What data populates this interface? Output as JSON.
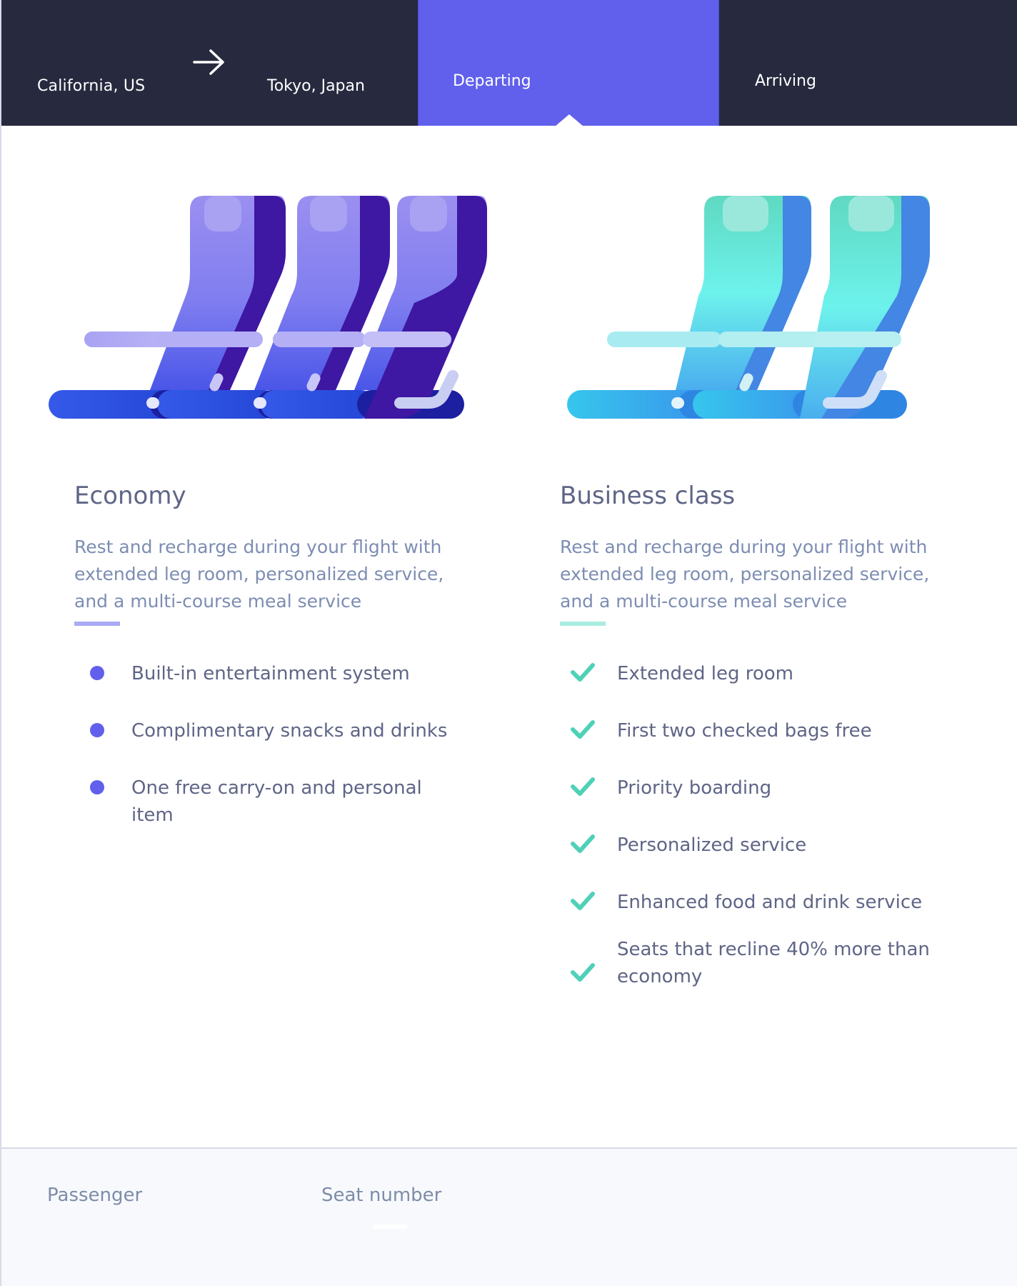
{
  "route": {
    "origin": "California, US",
    "destination": "Tokyo, Japan",
    "arrow_icon": "arrow-right-icon"
  },
  "tabs": [
    {
      "label": "Departing",
      "active": true
    },
    {
      "label": "Arriving",
      "active": false
    }
  ],
  "colors": {
    "nav_bg": "#272a3f",
    "accent_purple": "#6060ec",
    "accent_teal": "#4fd1b7",
    "text_primary": "#5f6586",
    "text_secondary": "#7d8db2"
  },
  "economy": {
    "title": "Economy",
    "description": "Rest and recharge during your flight with extended leg room, personalized service, and a multi-course meal service",
    "illustration_icon": "economy-seats-icon",
    "bullet_icon": "bullet-dot-icon",
    "features": [
      "Built-in entertainment system",
      "Complimentary snacks and drinks",
      "One free carry-on and personal item"
    ]
  },
  "business": {
    "title": "Business class",
    "description": "Rest and recharge during your flight with extended leg room, personalized service, and a multi-course meal service",
    "illustration_icon": "business-seats-icon",
    "bullet_icon": "checkmark-icon",
    "features": [
      "Extended leg room",
      "First two checked bags free",
      "Priority boarding",
      "Personalized service",
      "Enhanced food and drink service",
      "Seats that recline 40% more than economy"
    ]
  },
  "passenger_bar": {
    "passenger_label": "Passenger",
    "seat_label": "Seat number"
  }
}
